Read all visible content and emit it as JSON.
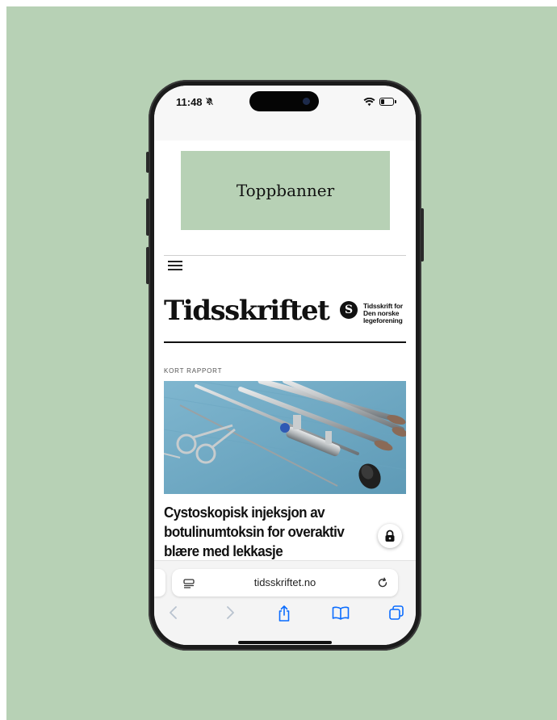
{
  "status_bar": {
    "time": "11:48",
    "silent_icon": "bell-slash-icon",
    "wifi_icon": "wifi-icon",
    "battery_icon": "battery-icon",
    "battery_level": 0.3
  },
  "ad": {
    "banner_label": "Toppbanner"
  },
  "site": {
    "menu_icon": "hamburger-menu-icon",
    "logo_text": "Tidsskriftet",
    "logo_mark": "S",
    "logo_sub": [
      "Tidsskrift for",
      "Den norske",
      "legeforening"
    ]
  },
  "article": {
    "kicker": "KORT RAPPORT",
    "image_subject": "surgical instruments on blue cloth",
    "headline": "Cystoskopisk injeksjon av\nbotulinumtoksin for overaktiv\nblære med lekkasje",
    "lock_icon": "padlock-icon"
  },
  "browser": {
    "url": "tidsskriftet.no",
    "reader_icon": "page-menu-icon",
    "reload_icon": "reload-icon",
    "nav": [
      "back-icon",
      "forward-icon",
      "share-icon",
      "bookmarks-icon",
      "tabs-icon"
    ]
  },
  "colors": {
    "background": "#b7d1b5",
    "accent": "#0a6cff",
    "text": "#111111"
  }
}
